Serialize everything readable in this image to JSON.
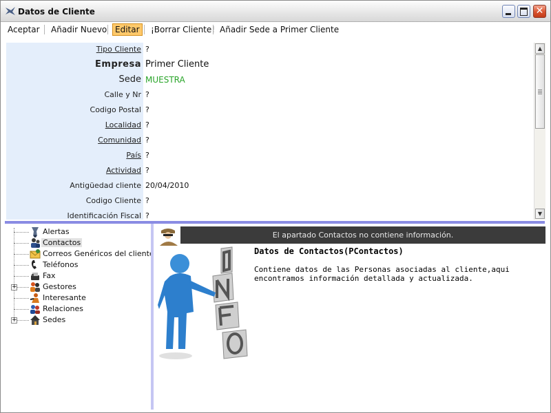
{
  "window": {
    "title": "Datos de Cliente"
  },
  "toolbar": {
    "items": [
      {
        "label": "Aceptar"
      },
      {
        "label": "Añadir Nuevo"
      },
      {
        "label": "Editar"
      },
      {
        "label": "¡Borrar Cliente!"
      },
      {
        "label": "Añadir Sede a Primer Cliente"
      }
    ]
  },
  "form": {
    "rows": [
      {
        "label": "Tipo Cliente",
        "value": "?"
      },
      {
        "label": "Empresa",
        "value": "Primer Cliente"
      },
      {
        "label": "Sede",
        "value": "MUESTRA"
      },
      {
        "label": "Calle y Nr",
        "value": "?"
      },
      {
        "label": "Codigo Postal",
        "value": "?"
      },
      {
        "label": "Localidad",
        "value": "?"
      },
      {
        "label": "Comunidad",
        "value": "?"
      },
      {
        "label": "País",
        "value": "?"
      },
      {
        "label": "Actividad",
        "value": "?"
      },
      {
        "label": "Antigüedad cliente",
        "value": "20/04/2010"
      },
      {
        "label": "Codigo Cliente",
        "value": "?"
      },
      {
        "label": "Identificación Fiscal",
        "value": "?"
      }
    ]
  },
  "tree": {
    "items": [
      {
        "label": "Alertas",
        "icon": "alert-bell-icon"
      },
      {
        "label": "Contactos",
        "icon": "contacts-people-icon",
        "selected": true
      },
      {
        "label": "Correos Genéricos del cliente",
        "icon": "mail-icon"
      },
      {
        "label": "Teléfonos",
        "icon": "phone-icon"
      },
      {
        "label": "Fax",
        "icon": "fax-icon"
      },
      {
        "label": "Gestores",
        "icon": "managers-icon",
        "expandable": true
      },
      {
        "label": "Interesante",
        "icon": "interesting-icon"
      },
      {
        "label": "Relaciones",
        "icon": "relations-icon"
      },
      {
        "label": "Sedes",
        "icon": "house-icon",
        "expandable": true
      }
    ]
  },
  "detail": {
    "banner": "El apartado Contactos no contiene información.",
    "title": "Datos de Contactos(PContactos)",
    "description": "Contiene datos de las Personas asociadas al cliente,aqui encontramos información detallada y actualizada."
  },
  "colors": {
    "accent_splitter": "#8a8ce3",
    "label_bg": "#e4eefb",
    "green_value": "#2aa52a",
    "active_tab": "#ffc96b"
  }
}
